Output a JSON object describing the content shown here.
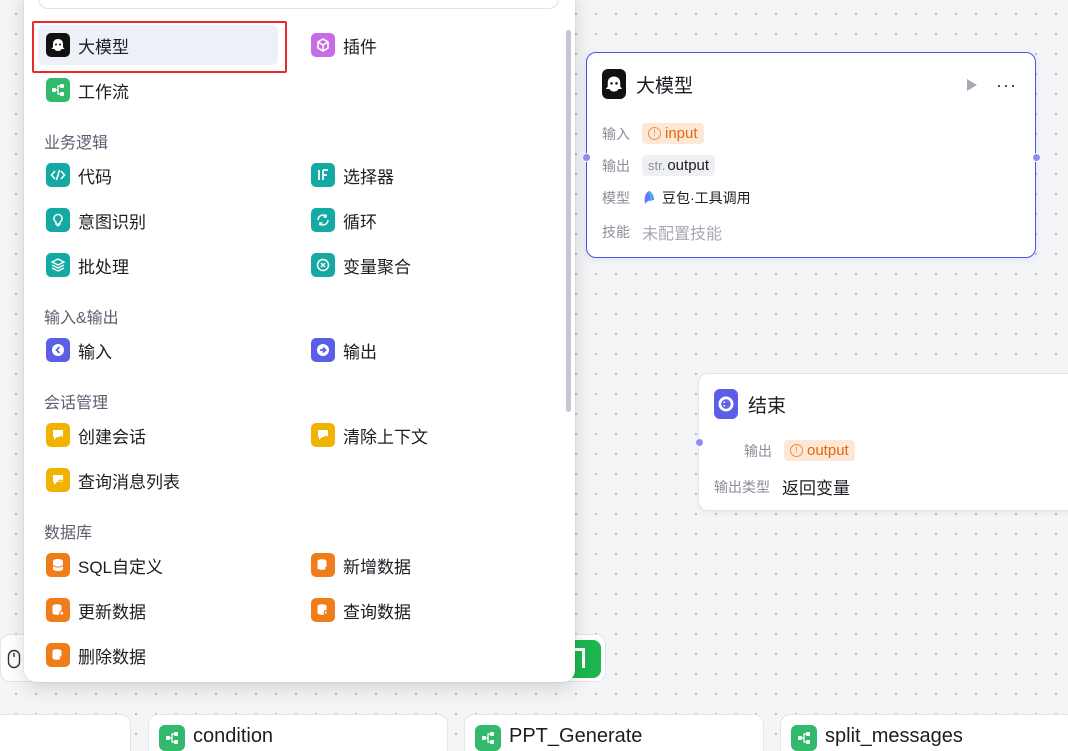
{
  "menu": {
    "top_items": [
      {
        "label": "大模型",
        "icon": "llm-icon",
        "selected": true
      },
      {
        "label": "插件",
        "icon": "plugin-icon"
      },
      {
        "label": "工作流",
        "icon": "workflow-icon"
      }
    ],
    "sections": [
      {
        "title": "业务逻辑",
        "items": [
          "代码",
          "选择器",
          "意图识别",
          "循环",
          "批处理",
          "变量聚合"
        ]
      },
      {
        "title": "输入&输出",
        "items": [
          "输入",
          "输出"
        ]
      },
      {
        "title": "会话管理",
        "items": [
          "创建会话",
          "清除上下文",
          "查询消息列表"
        ]
      },
      {
        "title": "数据库",
        "items": [
          "SQL自定义",
          "新增数据",
          "更新数据",
          "查询数据",
          "删除数据"
        ]
      }
    ]
  },
  "llm_node": {
    "title": "大模型",
    "input_label": "输入",
    "input_value": "input",
    "output_label": "输出",
    "output_prefix": "str.",
    "output_value": "output",
    "model_label": "模型",
    "model_value": "豆包·工具调用",
    "skill_label": "技能",
    "skill_value": "未配置技能"
  },
  "end_node": {
    "title": "结束",
    "output_label": "输出",
    "output_value": "output",
    "output_type_label": "输出类型",
    "output_type_value": "返回变量"
  },
  "bottom_bar": {
    "workflows": [
      "condition",
      "PPT_Generate",
      "split_messages"
    ]
  },
  "colors": {
    "accent": "#4d53e8",
    "highlight": "#e62b2b",
    "workflow_green": "#33b96c",
    "warning_orange": "#e5660c"
  }
}
